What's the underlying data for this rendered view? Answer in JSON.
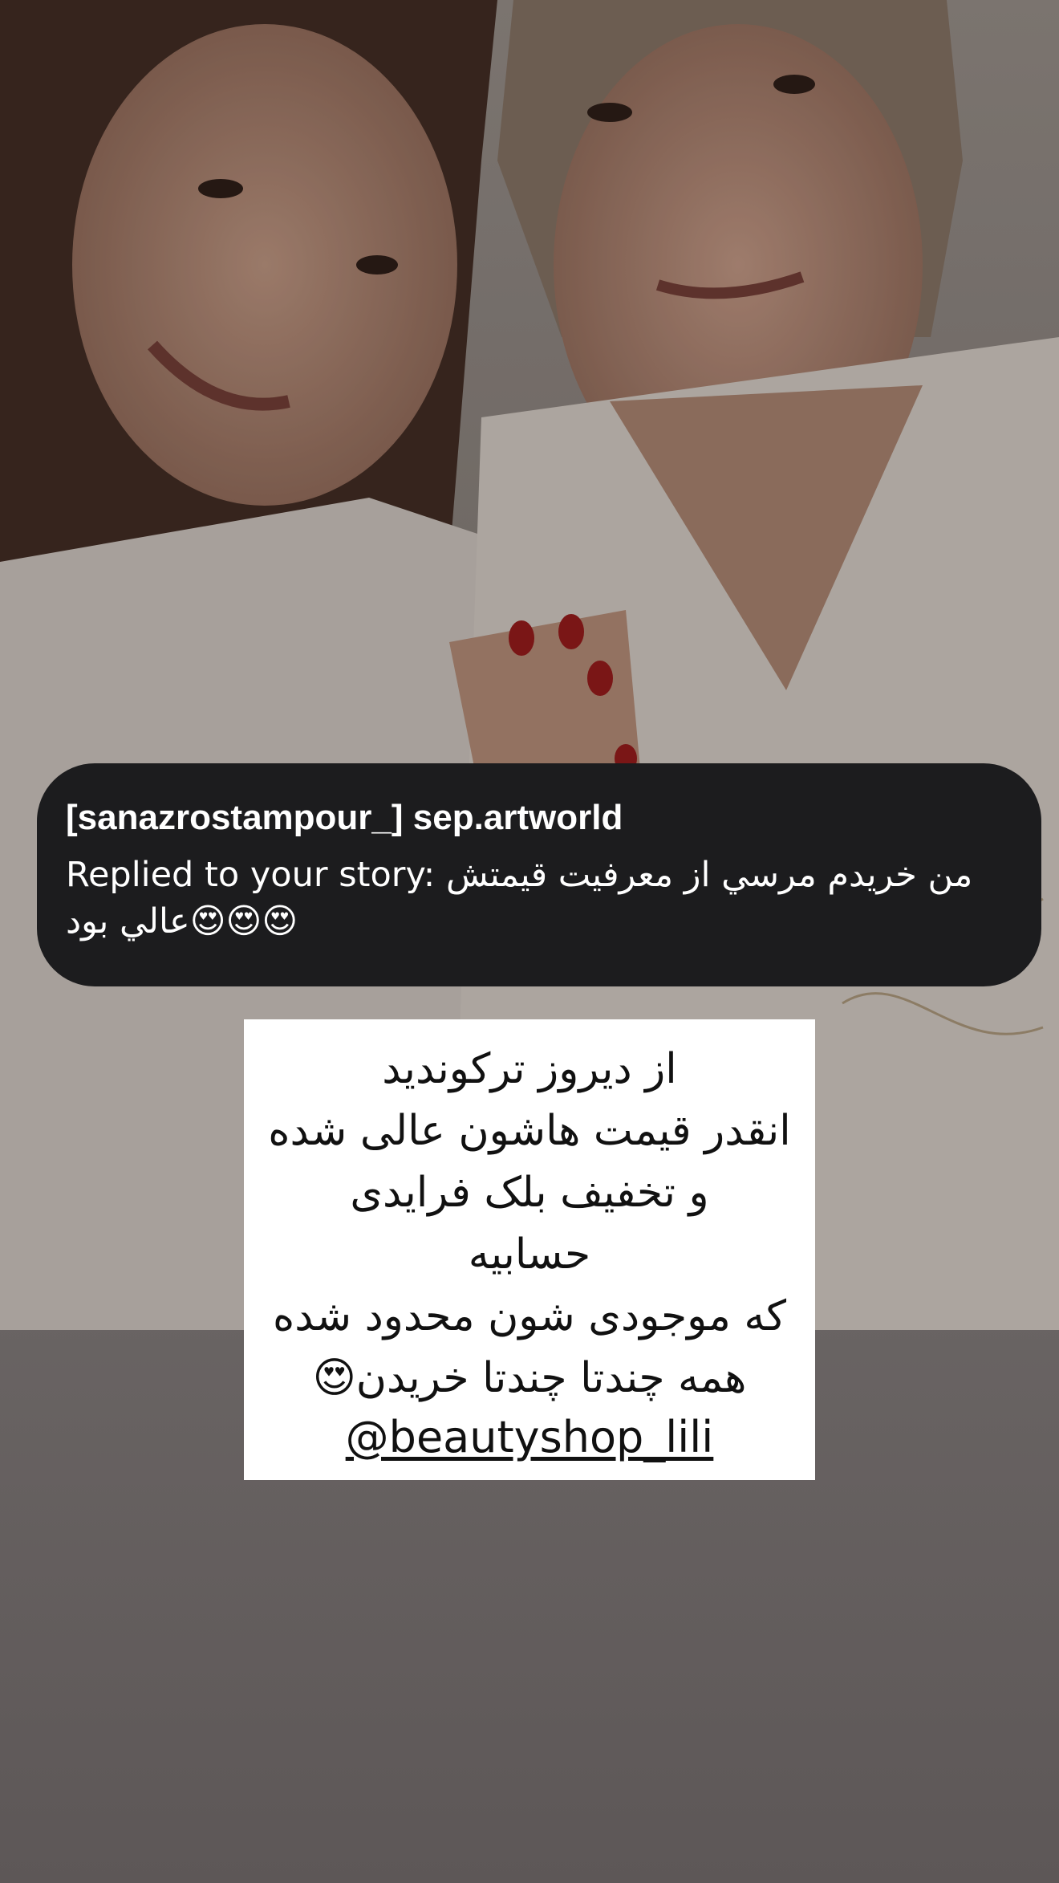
{
  "story_photo": {
    "description_icon": "photo-two-women"
  },
  "reply_card": {
    "title": "[sanazrostampour_] sep.artworld",
    "line1": "Replied to your story: من خريدم مرسي از معرفيت قيمتش",
    "line2": "😍😍😍عالي بود"
  },
  "post": {
    "lines": [
      "از دیروز ترکوندید",
      "انقدر قیمت هاشون عالی شده",
      "و تخفیف بلک فرایدی",
      "حسابیه",
      "که موجودی شون محدود شده",
      "همه چندتا چندتا خریدن😍"
    ],
    "mention": "@beautyshop_lili"
  },
  "colors": {
    "card_bg": "#1c1c1e",
    "post_bg": "#ffffff",
    "bottom_bg": "#6f6a69"
  }
}
